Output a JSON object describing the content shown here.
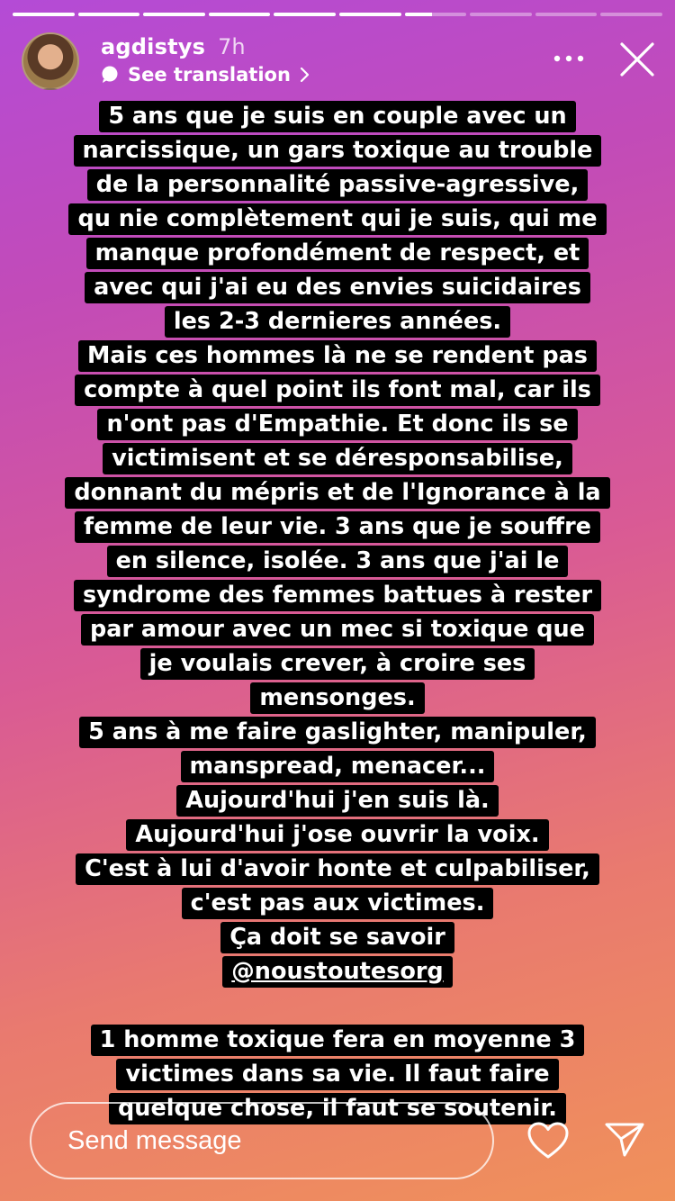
{
  "story": {
    "segments_total": 10,
    "current_segment": 7,
    "current_segment_progress": 0.45
  },
  "header": {
    "username": "agdistys",
    "time": "7h",
    "see_translation": "See translation",
    "more_icon": "more-horizontal-icon",
    "close_icon": "close-icon"
  },
  "story_text": {
    "lines": [
      "5 ans que je suis en couple avec un",
      "narcissique, un gars toxique au trouble",
      "de la personnalité passive-agressive,",
      "qu nie complètement qui je suis, qui me",
      "manque profondément de respect, et",
      "avec qui j'ai eu des envies suicidaires",
      "les 2-3 dernieres années.",
      "Mais ces hommes là ne se rendent pas",
      "compte à quel point ils font mal, car ils",
      "n'ont pas d'Empathie. Et donc ils se",
      "victimisent et se déresponsabilise,",
      "donnant du mépris et de l'Ignorance à la",
      "femme de leur vie. 3 ans que je souffre",
      "en silence, isolée. 3 ans que j'ai le",
      "syndrome des femmes battues à rester",
      "par amour avec un mec si toxique que",
      "je voulais crever, à croire ses",
      "mensonges.",
      "5 ans à me faire gaslighter, manipuler,",
      "manspread, menacer...",
      "Aujourd'hui j'en suis là.",
      "Aujourd'hui j'ose ouvrir la voix.",
      "C'est à lui d'avoir honte et culpabiliser,",
      "c'est pas aux victimes.",
      "Ça doit se savoir"
    ],
    "mention": "@noustoutesorg",
    "lines2": [
      "1 homme toxique fera en moyenne 3",
      "victimes dans sa vie. Il faut faire",
      "quelque chose, il faut se soutenir."
    ]
  },
  "footer": {
    "message_placeholder": "Send message",
    "like_icon": "heart-icon",
    "share_icon": "send-icon"
  },
  "colors": {
    "gradient_top": "#b44bd6",
    "gradient_mid": "#d95a95",
    "gradient_bottom": "#f0915a",
    "text_highlight": "#000000",
    "text": "#ffffff"
  }
}
